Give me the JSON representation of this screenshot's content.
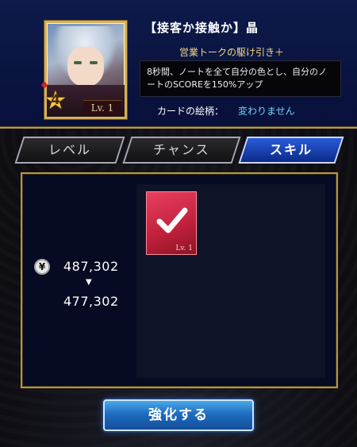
{
  "card": {
    "title": "【接客か接触か】晶",
    "rarity": "4",
    "level": "Lv. 1"
  },
  "skill": {
    "name": "営業トークの駆け引き＋",
    "description": "8秒間、ノートを全て自分の色とし、自分のノートのSCOREを150%アップ"
  },
  "card_pattern": {
    "label": "カードの絵柄：",
    "value": "変わりません"
  },
  "tabs": [
    {
      "label": "レベル",
      "active": false
    },
    {
      "label": "チャンス",
      "active": false
    },
    {
      "label": "スキル",
      "active": true
    }
  ],
  "money": {
    "icon": "yen-coin-icon",
    "symbol": "¥",
    "before": "487,302",
    "after": "477,302"
  },
  "material": {
    "level": "Lv. 1",
    "selected": true
  },
  "actions": {
    "enhance_label": "強化する"
  },
  "colors": {
    "accent_blue": "#1f6cc0",
    "gold_border": "#b7974a",
    "highlight_cyan": "#6fd3ff",
    "material_red": "#c0203a"
  }
}
